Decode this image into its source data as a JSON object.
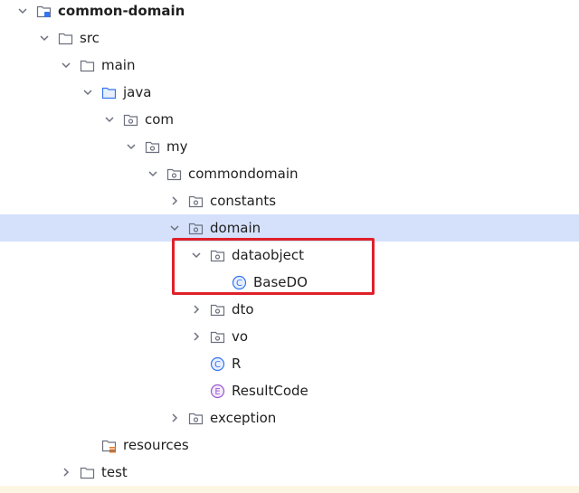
{
  "tree": {
    "rows": [
      {
        "label": "common-domain",
        "icon": "module-folder-icon",
        "expanded": true
      },
      {
        "label": "src",
        "icon": "folder-icon",
        "expanded": true
      },
      {
        "label": "main",
        "icon": "folder-icon",
        "expanded": true
      },
      {
        "label": "java",
        "icon": "source-folder-icon",
        "expanded": true
      },
      {
        "label": "com",
        "icon": "package-icon",
        "expanded": true
      },
      {
        "label": "my",
        "icon": "package-icon",
        "expanded": true
      },
      {
        "label": "commondomain",
        "icon": "package-icon",
        "expanded": true
      },
      {
        "label": "constants",
        "icon": "package-icon",
        "expanded": false
      },
      {
        "label": "domain",
        "icon": "package-icon",
        "expanded": true
      },
      {
        "label": "dataobject",
        "icon": "package-icon",
        "expanded": true
      },
      {
        "label": "BaseDO",
        "icon": "class-icon"
      },
      {
        "label": "dto",
        "icon": "package-icon",
        "expanded": false
      },
      {
        "label": "vo",
        "icon": "package-icon",
        "expanded": false
      },
      {
        "label": "R",
        "icon": "class-icon"
      },
      {
        "label": "ResultCode",
        "icon": "enum-icon"
      },
      {
        "label": "exception",
        "icon": "package-icon",
        "expanded": false
      },
      {
        "label": "resources",
        "icon": "resources-folder-icon"
      },
      {
        "label": "test",
        "icon": "folder-icon",
        "expanded": false
      }
    ]
  },
  "colors": {
    "selection": "#d5e1fb",
    "highlight_border": "#e0202a",
    "class_icon": "#3574f0",
    "enum_icon": "#9b59d0"
  }
}
